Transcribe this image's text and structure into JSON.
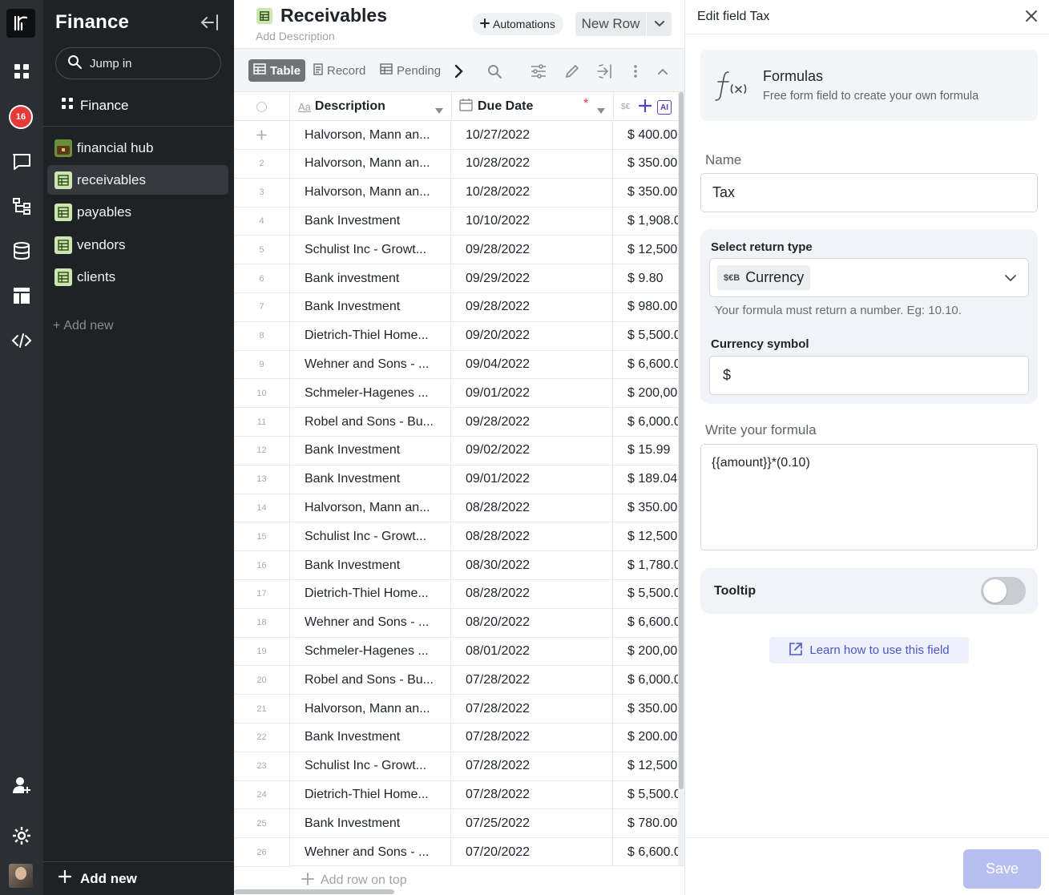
{
  "rail": {
    "badge_count": "16",
    "icons": [
      "logo-icon",
      "apps-grid-icon",
      "notifications-icon",
      "chat-icon",
      "hierarchy-icon",
      "database-icon",
      "layout-icon",
      "code-icon",
      "add-user-icon",
      "gear-icon",
      "avatar"
    ]
  },
  "sidebar": {
    "title": "Finance",
    "search_placeholder": "Jump in",
    "workspace": "Finance",
    "items": [
      {
        "label": "financial hub",
        "icon": "hub-icon"
      },
      {
        "label": "receivables",
        "icon": "table-icon",
        "active": true
      },
      {
        "label": "payables",
        "icon": "table-icon"
      },
      {
        "label": "vendors",
        "icon": "table-icon"
      },
      {
        "label": "clients",
        "icon": "table-icon"
      }
    ],
    "add_new": "Add new",
    "bottom_add_new": "Add new"
  },
  "header": {
    "title": "Receivables",
    "description_placeholder": "Add Description",
    "automations": "Automations",
    "new_row": "New Row"
  },
  "toolbar": {
    "tabs": [
      "Table",
      "Record",
      "Pending"
    ]
  },
  "table": {
    "columns": {
      "description": "Description",
      "due_date": "Due Date",
      "required_mark": "*",
      "desc_type_icon": "Aa",
      "amount_type_icon": "$€",
      "ai_label": "AI"
    },
    "rows": [
      {
        "num": "",
        "description": "Halvorson, Mann an...",
        "due_date": "10/27/2022",
        "amount": "$ 400.00"
      },
      {
        "num": "2",
        "description": "Halvorson, Mann an...",
        "due_date": "10/28/2022",
        "amount": "$ 350.00"
      },
      {
        "num": "3",
        "description": "Halvorson, Mann an...",
        "due_date": "10/28/2022",
        "amount": "$ 350.00"
      },
      {
        "num": "4",
        "description": "Bank Investment",
        "due_date": "10/10/2022",
        "amount": "$ 1,908.0"
      },
      {
        "num": "5",
        "description": "Schulist Inc - Growt...",
        "due_date": "09/28/2022",
        "amount": "$ 12,500"
      },
      {
        "num": "6",
        "description": "Bank investment",
        "due_date": "09/29/2022",
        "amount": "$ 9.80"
      },
      {
        "num": "7",
        "description": "Bank Investment",
        "due_date": "09/28/2022",
        "amount": "$ 980.00"
      },
      {
        "num": "8",
        "description": "Dietrich-Thiel Home...",
        "due_date": "09/20/2022",
        "amount": "$ 5,500.0"
      },
      {
        "num": "9",
        "description": "Wehner and Sons - ...",
        "due_date": "09/04/2022",
        "amount": "$ 6,600.0"
      },
      {
        "num": "10",
        "description": "Schmeler-Hagenes ...",
        "due_date": "09/01/2022",
        "amount": "$ 200,00"
      },
      {
        "num": "11",
        "description": "Robel and Sons - Bu...",
        "due_date": "09/28/2022",
        "amount": "$ 6,000.0"
      },
      {
        "num": "12",
        "description": "Bank Investment",
        "due_date": "09/02/2022",
        "amount": "$ 15.99"
      },
      {
        "num": "13",
        "description": "Bank Investment",
        "due_date": "09/01/2022",
        "amount": "$ 189.04"
      },
      {
        "num": "14",
        "description": "Halvorson, Mann an...",
        "due_date": "08/28/2022",
        "amount": "$ 350.00"
      },
      {
        "num": "15",
        "description": "Schulist Inc - Growt...",
        "due_date": "08/28/2022",
        "amount": "$ 12,500"
      },
      {
        "num": "16",
        "description": "Bank Investment",
        "due_date": "08/30/2022",
        "amount": "$ 1,780.0"
      },
      {
        "num": "17",
        "description": "Dietrich-Thiel Home...",
        "due_date": "08/28/2022",
        "amount": "$ 5,500.0"
      },
      {
        "num": "18",
        "description": "Wehner and Sons - ...",
        "due_date": "08/20/2022",
        "amount": "$ 6,600.0"
      },
      {
        "num": "19",
        "description": "Schmeler-Hagenes ...",
        "due_date": "08/01/2022",
        "amount": "$ 200,00"
      },
      {
        "num": "20",
        "description": "Robel and Sons - Bu...",
        "due_date": "07/28/2022",
        "amount": "$ 6,000.0"
      },
      {
        "num": "21",
        "description": "Halvorson, Mann an...",
        "due_date": "07/28/2022",
        "amount": "$ 350.00"
      },
      {
        "num": "22",
        "description": "Bank Investment",
        "due_date": "07/28/2022",
        "amount": "$ 200.00"
      },
      {
        "num": "23",
        "description": "Schulist Inc - Growt...",
        "due_date": "07/28/2022",
        "amount": "$ 12,500"
      },
      {
        "num": "24",
        "description": "Dietrich-Thiel Home...",
        "due_date": "07/28/2022",
        "amount": "$ 5,500.0"
      },
      {
        "num": "25",
        "description": "Bank Investment",
        "due_date": "07/25/2022",
        "amount": "$ 780.00"
      },
      {
        "num": "26",
        "description": "Wehner and Sons - ...",
        "due_date": "07/20/2022",
        "amount": "$ 6,600.0"
      }
    ],
    "add_row_on_top": "Add row on top"
  },
  "panel": {
    "title": "Edit field Tax",
    "formula_card": {
      "title": "Formulas",
      "subtitle": "Free form field to create your own formula"
    },
    "name_label": "Name",
    "name_value": "Tax",
    "return_type_label": "Select return type",
    "return_type_symbol": "$€B",
    "return_type_value": "Currency",
    "return_type_help": "Your formula must return a number. Eg: 10.10.",
    "currency_symbol_label": "Currency symbol",
    "currency_symbol_value": "$",
    "formula_label": "Write your formula",
    "formula_value": "{{amount}}*(0.10)",
    "tooltip_label": "Tooltip",
    "tooltip_on": false,
    "learn_link": "Learn how to use this field",
    "save": "Save"
  },
  "colors": {
    "rail_bg": "#2b2f33",
    "sidebar_bg": "#1f2224",
    "accent": "#4b57c8",
    "save_disabled": "#b7bff0",
    "badge": "#e53935"
  }
}
